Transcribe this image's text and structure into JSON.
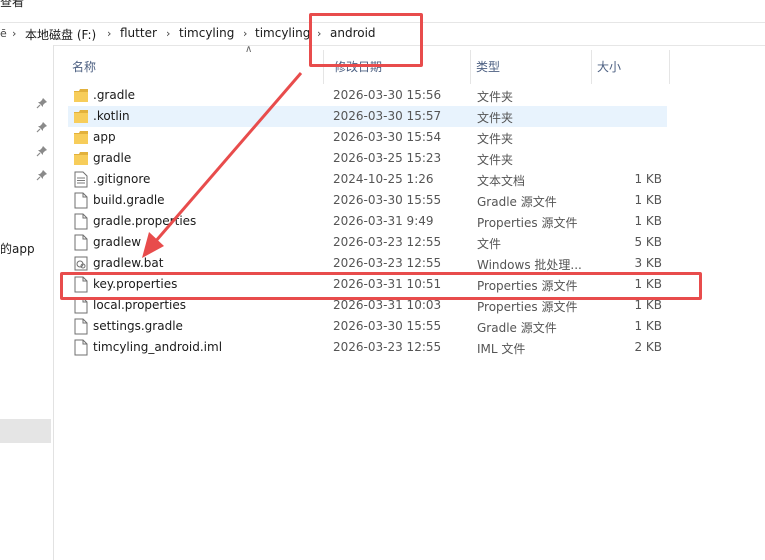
{
  "top_cut_text": "查看",
  "breadcrumb": {
    "items": [
      "本地磁盘 (F:)",
      "flutter",
      "timcyling",
      "timcyling",
      "android"
    ]
  },
  "nav": {
    "partial_label": "的app"
  },
  "columns": {
    "name": "名称",
    "modified": "修改日期",
    "type": "类型",
    "size": "大小"
  },
  "files": [
    {
      "name": ".gradle",
      "date": "2026-03-30 15:56",
      "type": "文件夹",
      "size": "",
      "icon": "folder-icon"
    },
    {
      "name": ".kotlin",
      "date": "2026-03-30 15:57",
      "type": "文件夹",
      "size": "",
      "icon": "folder-icon"
    },
    {
      "name": "app",
      "date": "2026-03-30 15:54",
      "type": "文件夹",
      "size": "",
      "icon": "folder-icon"
    },
    {
      "name": "gradle",
      "date": "2026-03-25 15:23",
      "type": "文件夹",
      "size": "",
      "icon": "folder-icon"
    },
    {
      "name": ".gitignore",
      "date": "2024-10-25 1:26",
      "type": "文本文档",
      "size": "1 KB",
      "icon": "text-file-icon"
    },
    {
      "name": "build.gradle",
      "date": "2026-03-30 15:55",
      "type": "Gradle 源文件",
      "size": "1 KB",
      "icon": "file-icon"
    },
    {
      "name": "gradle.properties",
      "date": "2026-03-31 9:49",
      "type": "Properties 源文件",
      "size": "1 KB",
      "icon": "file-icon"
    },
    {
      "name": "gradlew",
      "date": "2026-03-23 12:55",
      "type": "文件",
      "size": "5 KB",
      "icon": "file-icon"
    },
    {
      "name": "gradlew.bat",
      "date": "2026-03-23 12:55",
      "type": "Windows 批处理...",
      "size": "3 KB",
      "icon": "batch-file-icon"
    },
    {
      "name": "key.properties",
      "date": "2026-03-31 10:51",
      "type": "Properties 源文件",
      "size": "1 KB",
      "icon": "file-icon"
    },
    {
      "name": "local.properties",
      "date": "2026-03-31 10:03",
      "type": "Properties 源文件",
      "size": "1 KB",
      "icon": "file-icon"
    },
    {
      "name": "settings.gradle",
      "date": "2026-03-30 15:55",
      "type": "Gradle 源文件",
      "size": "1 KB",
      "icon": "file-icon"
    },
    {
      "name": "timcyling_android.iml",
      "date": "2026-03-23 12:55",
      "type": "IML 文件",
      "size": "2 KB",
      "icon": "file-icon"
    }
  ],
  "colors": {
    "annotation": "#e84c4c",
    "selected_row": "#e8f3fd",
    "folder": "#f7cd5a",
    "header_text": "#4d6082"
  }
}
